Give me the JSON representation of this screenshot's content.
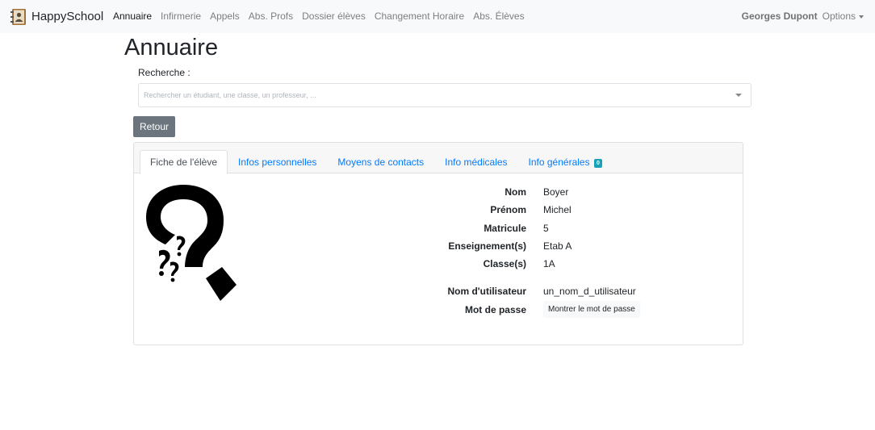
{
  "brand": {
    "name": "HappySchool",
    "icon": "address-book-icon"
  },
  "nav": {
    "items": [
      {
        "label": "Annuaire",
        "active": true
      },
      {
        "label": "Infirmerie"
      },
      {
        "label": "Appels"
      },
      {
        "label": "Abs. Profs"
      },
      {
        "label": "Dossier élèves"
      },
      {
        "label": "Changement Horaire"
      },
      {
        "label": "Abs. Élèves"
      }
    ],
    "user": "Georges Dupont",
    "options": "Options"
  },
  "page": {
    "title": "Annuaire"
  },
  "search": {
    "label": "Recherche :",
    "placeholder": "Rechercher un étudiant, une classe, un professeur, ..."
  },
  "back_button": "Retour",
  "tabs": [
    {
      "label": "Fiche de l'élève",
      "active": true
    },
    {
      "label": "Infos personnelles"
    },
    {
      "label": "Moyens de contacts"
    },
    {
      "label": "Info médicales"
    },
    {
      "label": "Info générales",
      "badge": "0"
    }
  ],
  "student": {
    "fields": [
      {
        "label": "Nom",
        "value": "Boyer"
      },
      {
        "label": "Prénom",
        "value": "Michel"
      },
      {
        "label": "Matricule",
        "value": "5"
      },
      {
        "label": "Enseignement(s)",
        "value": "Etab A"
      },
      {
        "label": "Classe(s)",
        "value": "1A"
      }
    ],
    "username_label": "Nom d'utilisateur",
    "username": "un_nom_d_utilisateur",
    "password_label": "Mot de passe",
    "password_button": "Montrer le mot de passe"
  },
  "colors": {
    "navbar_bg": "#f8f9fa",
    "link": "#007bff",
    "secondary_button": "#6c757d",
    "badge": "#17a2b8"
  }
}
